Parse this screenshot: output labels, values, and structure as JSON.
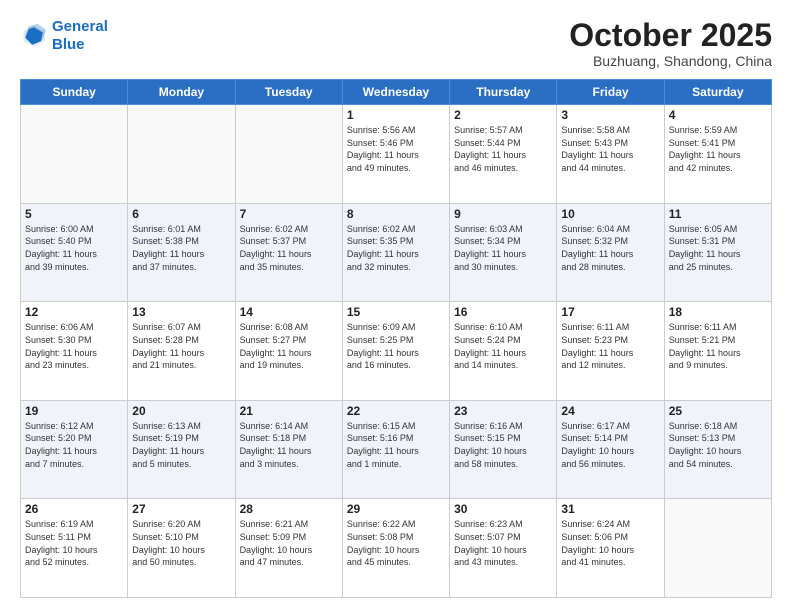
{
  "header": {
    "logo_line1": "General",
    "logo_line2": "Blue",
    "month": "October 2025",
    "location": "Buzhuang, Shandong, China"
  },
  "days_of_week": [
    "Sunday",
    "Monday",
    "Tuesday",
    "Wednesday",
    "Thursday",
    "Friday",
    "Saturday"
  ],
  "weeks": [
    {
      "shaded": false,
      "days": [
        {
          "number": "",
          "info": ""
        },
        {
          "number": "",
          "info": ""
        },
        {
          "number": "",
          "info": ""
        },
        {
          "number": "1",
          "info": "Sunrise: 5:56 AM\nSunset: 5:46 PM\nDaylight: 11 hours\nand 49 minutes."
        },
        {
          "number": "2",
          "info": "Sunrise: 5:57 AM\nSunset: 5:44 PM\nDaylight: 11 hours\nand 46 minutes."
        },
        {
          "number": "3",
          "info": "Sunrise: 5:58 AM\nSunset: 5:43 PM\nDaylight: 11 hours\nand 44 minutes."
        },
        {
          "number": "4",
          "info": "Sunrise: 5:59 AM\nSunset: 5:41 PM\nDaylight: 11 hours\nand 42 minutes."
        }
      ]
    },
    {
      "shaded": true,
      "days": [
        {
          "number": "5",
          "info": "Sunrise: 6:00 AM\nSunset: 5:40 PM\nDaylight: 11 hours\nand 39 minutes."
        },
        {
          "number": "6",
          "info": "Sunrise: 6:01 AM\nSunset: 5:38 PM\nDaylight: 11 hours\nand 37 minutes."
        },
        {
          "number": "7",
          "info": "Sunrise: 6:02 AM\nSunset: 5:37 PM\nDaylight: 11 hours\nand 35 minutes."
        },
        {
          "number": "8",
          "info": "Sunrise: 6:02 AM\nSunset: 5:35 PM\nDaylight: 11 hours\nand 32 minutes."
        },
        {
          "number": "9",
          "info": "Sunrise: 6:03 AM\nSunset: 5:34 PM\nDaylight: 11 hours\nand 30 minutes."
        },
        {
          "number": "10",
          "info": "Sunrise: 6:04 AM\nSunset: 5:32 PM\nDaylight: 11 hours\nand 28 minutes."
        },
        {
          "number": "11",
          "info": "Sunrise: 6:05 AM\nSunset: 5:31 PM\nDaylight: 11 hours\nand 25 minutes."
        }
      ]
    },
    {
      "shaded": false,
      "days": [
        {
          "number": "12",
          "info": "Sunrise: 6:06 AM\nSunset: 5:30 PM\nDaylight: 11 hours\nand 23 minutes."
        },
        {
          "number": "13",
          "info": "Sunrise: 6:07 AM\nSunset: 5:28 PM\nDaylight: 11 hours\nand 21 minutes."
        },
        {
          "number": "14",
          "info": "Sunrise: 6:08 AM\nSunset: 5:27 PM\nDaylight: 11 hours\nand 19 minutes."
        },
        {
          "number": "15",
          "info": "Sunrise: 6:09 AM\nSunset: 5:25 PM\nDaylight: 11 hours\nand 16 minutes."
        },
        {
          "number": "16",
          "info": "Sunrise: 6:10 AM\nSunset: 5:24 PM\nDaylight: 11 hours\nand 14 minutes."
        },
        {
          "number": "17",
          "info": "Sunrise: 6:11 AM\nSunset: 5:23 PM\nDaylight: 11 hours\nand 12 minutes."
        },
        {
          "number": "18",
          "info": "Sunrise: 6:11 AM\nSunset: 5:21 PM\nDaylight: 11 hours\nand 9 minutes."
        }
      ]
    },
    {
      "shaded": true,
      "days": [
        {
          "number": "19",
          "info": "Sunrise: 6:12 AM\nSunset: 5:20 PM\nDaylight: 11 hours\nand 7 minutes."
        },
        {
          "number": "20",
          "info": "Sunrise: 6:13 AM\nSunset: 5:19 PM\nDaylight: 11 hours\nand 5 minutes."
        },
        {
          "number": "21",
          "info": "Sunrise: 6:14 AM\nSunset: 5:18 PM\nDaylight: 11 hours\nand 3 minutes."
        },
        {
          "number": "22",
          "info": "Sunrise: 6:15 AM\nSunset: 5:16 PM\nDaylight: 11 hours\nand 1 minute."
        },
        {
          "number": "23",
          "info": "Sunrise: 6:16 AM\nSunset: 5:15 PM\nDaylight: 10 hours\nand 58 minutes."
        },
        {
          "number": "24",
          "info": "Sunrise: 6:17 AM\nSunset: 5:14 PM\nDaylight: 10 hours\nand 56 minutes."
        },
        {
          "number": "25",
          "info": "Sunrise: 6:18 AM\nSunset: 5:13 PM\nDaylight: 10 hours\nand 54 minutes."
        }
      ]
    },
    {
      "shaded": false,
      "days": [
        {
          "number": "26",
          "info": "Sunrise: 6:19 AM\nSunset: 5:11 PM\nDaylight: 10 hours\nand 52 minutes."
        },
        {
          "number": "27",
          "info": "Sunrise: 6:20 AM\nSunset: 5:10 PM\nDaylight: 10 hours\nand 50 minutes."
        },
        {
          "number": "28",
          "info": "Sunrise: 6:21 AM\nSunset: 5:09 PM\nDaylight: 10 hours\nand 47 minutes."
        },
        {
          "number": "29",
          "info": "Sunrise: 6:22 AM\nSunset: 5:08 PM\nDaylight: 10 hours\nand 45 minutes."
        },
        {
          "number": "30",
          "info": "Sunrise: 6:23 AM\nSunset: 5:07 PM\nDaylight: 10 hours\nand 43 minutes."
        },
        {
          "number": "31",
          "info": "Sunrise: 6:24 AM\nSunset: 5:06 PM\nDaylight: 10 hours\nand 41 minutes."
        },
        {
          "number": "",
          "info": ""
        }
      ]
    }
  ]
}
